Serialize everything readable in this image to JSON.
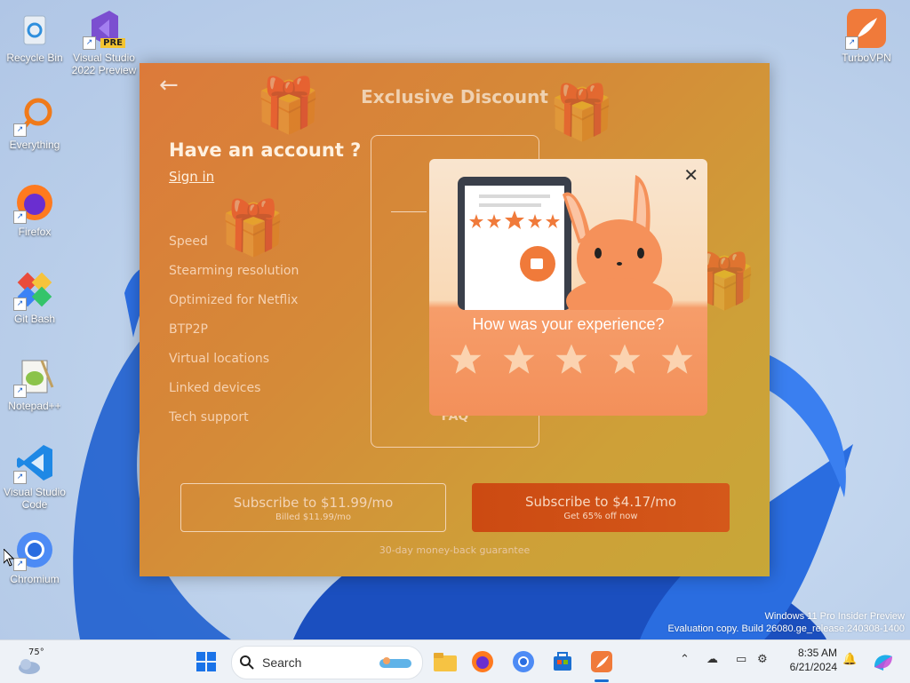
{
  "desktop": {
    "icons": [
      {
        "label": "Recycle Bin",
        "icon": "recycle-bin-icon"
      },
      {
        "label": "Visual Studio 2022 Preview",
        "icon": "visual-studio-preview-icon",
        "badge": "PRE"
      },
      {
        "label": "Everything",
        "icon": "everything-search-icon"
      },
      {
        "label": "Firefox",
        "icon": "firefox-icon"
      },
      {
        "label": "Git Bash",
        "icon": "git-bash-icon"
      },
      {
        "label": "Notepad++",
        "icon": "notepad-plus-plus-icon"
      },
      {
        "label": "Visual Studio Code",
        "icon": "vscode-icon"
      },
      {
        "label": "Chromium",
        "icon": "chromium-icon"
      },
      {
        "label": "TurboVPN",
        "icon": "turbovpn-icon"
      }
    ]
  },
  "app": {
    "title": "Exclusive Discount",
    "account_prompt": "Have an account ?",
    "sign_in": "Sign in",
    "features": [
      "Speed",
      "Stearming resolution",
      "Optimized for Netflix",
      "BTP2P",
      "Virtual locations",
      "Linked devices",
      "Tech support"
    ],
    "faq": "FAQ",
    "plan_monthly": {
      "label": "Subscribe to $11.99/mo",
      "sub": "Billed $11.99/mo"
    },
    "plan_discount": {
      "label": "Subscribe to $4.17/mo",
      "sub": "Get 65% off now"
    },
    "guarantee": "30-day money-back guarantee"
  },
  "popup": {
    "question": "How was your experience?",
    "star_count": 5
  },
  "watermark": {
    "line1": "Windows 11 Pro Insider Preview",
    "line2": "Evaluation copy. Build 26080.ge_release.240308-1400"
  },
  "taskbar": {
    "weather_temp": "75°",
    "search_placeholder": "Search",
    "time": "8:35 AM",
    "date": "6/21/2024"
  },
  "colors": {
    "app_accent": "#dc7a3a",
    "popup_orange": "#f3905a",
    "discount_button": "#cc4a12"
  }
}
